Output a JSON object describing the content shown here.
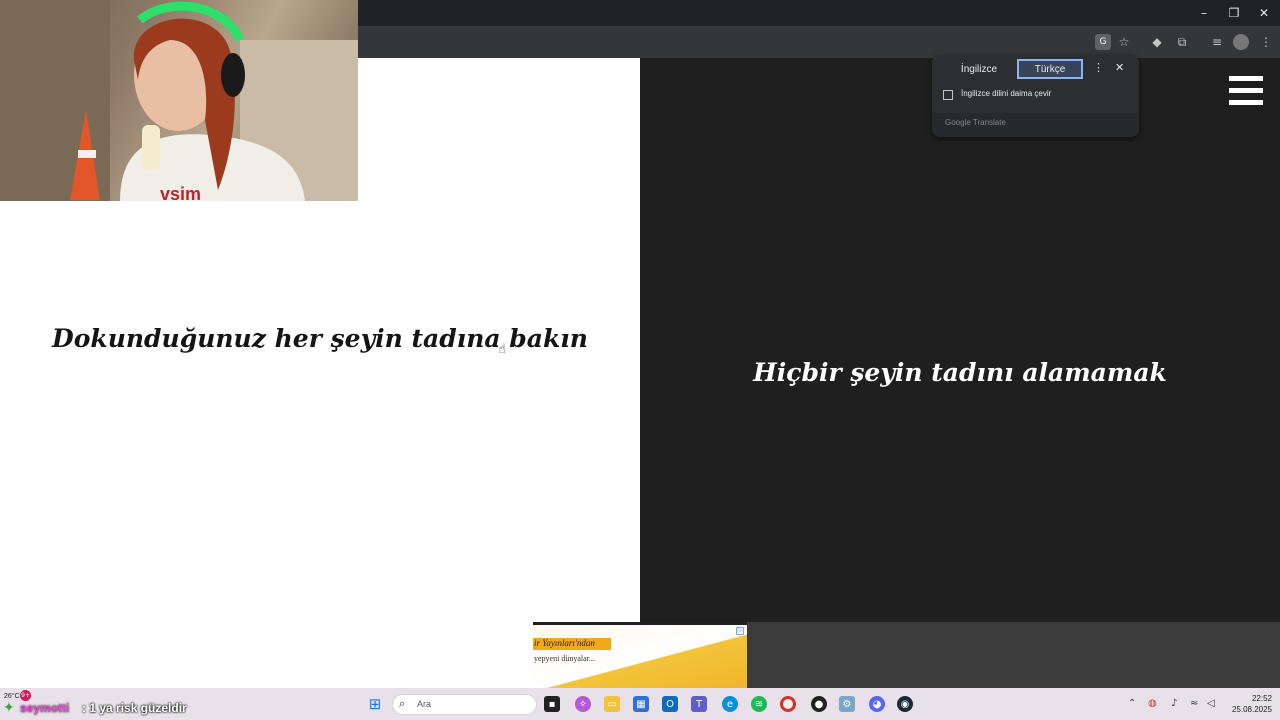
{
  "window": {
    "minimize": "–",
    "maximize": "❐",
    "close": "✕"
  },
  "toolbar": {
    "icons": [
      "translate-icon",
      "star-icon",
      "extension-diamond-icon",
      "puzzle-icon",
      "media-icon",
      "profile-icon",
      "menu-dots-icon"
    ]
  },
  "page": {
    "left_text": "Dokunduğunuz her şeyin tadına bakın",
    "right_text": "Hiçbir şeyin tadını alamamak"
  },
  "translate_popup": {
    "lang_from": "İngilizce",
    "lang_to": "Türkçe",
    "always_translate_label": "İngilizce dilini daima çevir",
    "footer": "Google Translate",
    "more": "⋮",
    "close": "✕"
  },
  "ad": {
    "line1": "ir Yayınları'ndan",
    "line2": "yepyeni dünyalar..."
  },
  "taskbar": {
    "weather": "26°C",
    "search_placeholder": "Ara",
    "clock_time": "22:52",
    "clock_date": "25.08.2025",
    "notification_count": "9+"
  },
  "stream_chat": {
    "user": "seymotti",
    "message": ": 1 ya risk güzeldir"
  },
  "colors": {
    "accent": "#8ab4f8",
    "chat_user": "#e74bd1",
    "taskbar": "#e8e1ea"
  }
}
